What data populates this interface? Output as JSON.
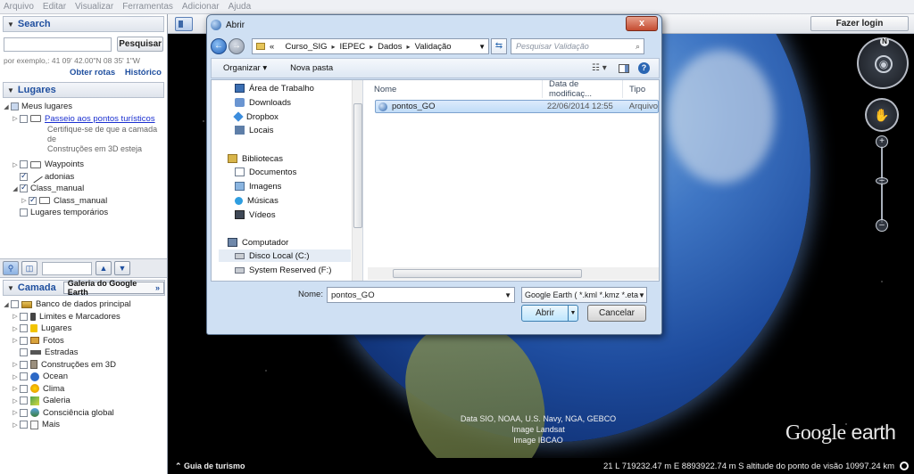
{
  "menu": [
    "Arquivo",
    "Editar",
    "Visualizar",
    "Ferramentas",
    "Adicionar",
    "Ajuda"
  ],
  "search": {
    "title": "Search",
    "button": "Pesquisar",
    "hint": "por exemplo,: 41 09' 42.00\"N 08 35' 1\"W",
    "link_routes": "Obter rotas",
    "link_history": "Histórico"
  },
  "places": {
    "title": "Lugares",
    "items": [
      {
        "label": "Meus lugares"
      },
      {
        "label": "Passeio aos pontos turísticos"
      },
      {
        "label": "Waypoints"
      },
      {
        "label": "adonias"
      },
      {
        "label": "Class_manual"
      },
      {
        "label": "Class_manual"
      },
      {
        "label": "Lugares temporários"
      }
    ],
    "tour_desc_1": "Certifique-se de que a camada de",
    "tour_desc_2": "Construções em 3D esteja"
  },
  "layers": {
    "title": "Camada",
    "gallery": "Galeria do Google Earth",
    "gallery_arrow": "»",
    "items": [
      {
        "label": "Banco de dados principal"
      },
      {
        "label": "Limites e Marcadores"
      },
      {
        "label": "Lugares"
      },
      {
        "label": "Fotos"
      },
      {
        "label": "Estradas"
      },
      {
        "label": "Construções em 3D"
      },
      {
        "label": "Ocean"
      },
      {
        "label": "Clima"
      },
      {
        "label": "Galeria"
      },
      {
        "label": "Consciência global"
      },
      {
        "label": "Mais"
      }
    ]
  },
  "toolbar": {
    "login": "Fazer login"
  },
  "earth": {
    "attribution": [
      "Data SIO, NOAA, U.S. Navy, NGA, GEBCO",
      "Image Landsat",
      "Image IBCAO"
    ],
    "logo_main": "Google",
    "logo_sub": " earth",
    "tour_guide": "Guia de turismo",
    "status": "21 L 719232.47 m E 8893922.74 m S  altitude do ponto de visão 10997.24 km",
    "compass_n": "N"
  },
  "dialog": {
    "title": "Abrir",
    "close": "x",
    "breadcrumb": [
      "«",
      "Curso_SIG",
      "IEPEC",
      "Dados",
      "Validação"
    ],
    "search_placeholder": "Pesquisar Validação",
    "organize": "Organizar ▾",
    "new_folder": "Nova pasta",
    "nav_items": [
      {
        "label": "Área de Trabalho"
      },
      {
        "label": "Downloads"
      },
      {
        "label": "Dropbox"
      },
      {
        "label": "Locais"
      },
      {
        "label": "Bibliotecas"
      },
      {
        "label": "Documentos"
      },
      {
        "label": "Imagens"
      },
      {
        "label": "Músicas"
      },
      {
        "label": "Vídeos"
      },
      {
        "label": "Computador"
      },
      {
        "label": "Disco Local (C:)"
      },
      {
        "label": "System Reserved (F:)"
      }
    ],
    "columns": {
      "name": "Nome",
      "modified": "Data de modificaç...",
      "type": "Tipo"
    },
    "files": [
      {
        "name": "pontos_GO",
        "modified": "22/06/2014 12:55",
        "type": "Arquivo"
      }
    ],
    "name_label": "Nome:",
    "name_value": "pontos_GO",
    "filetype": "Google Earth ( *.kml *.kmz *.eta",
    "open": "Abrir",
    "cancel": "Cancelar"
  }
}
